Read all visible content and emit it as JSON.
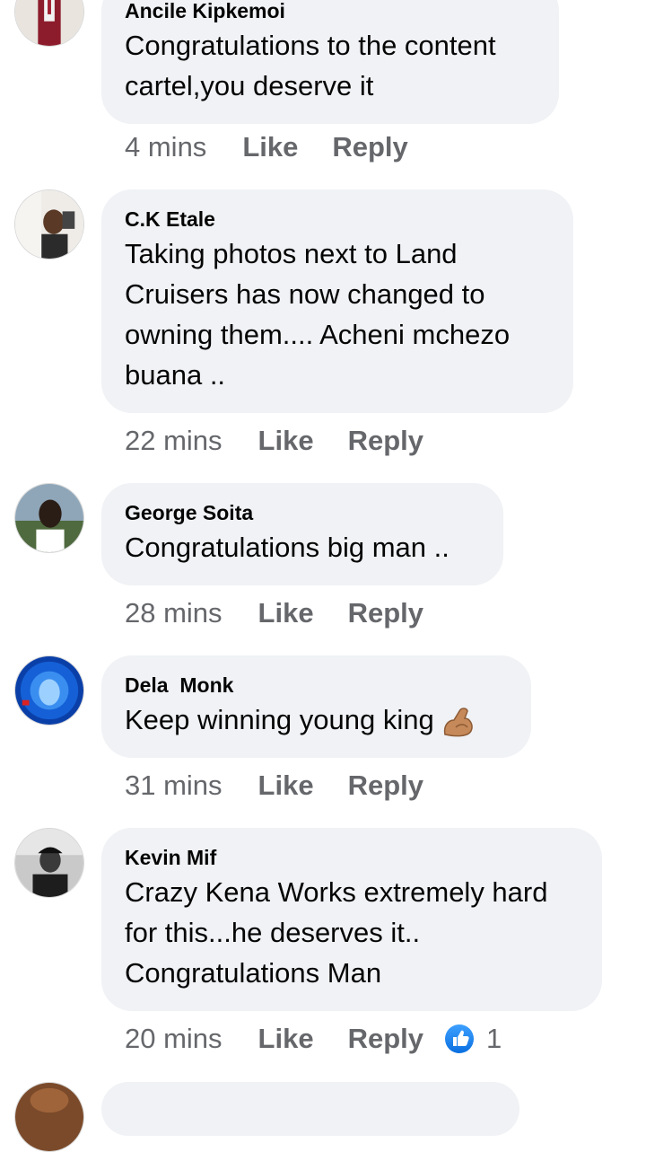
{
  "comments": [
    {
      "author": "Ancile Kipkemoi",
      "text": "Congratulations to the content cartel,you deserve it",
      "time": "4 mins",
      "like": "Like",
      "reply": "Reply"
    },
    {
      "author": "C.K Etale",
      "text": "Taking photos next to Land Cruisers has now changed to owning them.... Acheni mchezo buana ..",
      "time": "22 mins",
      "like": "Like",
      "reply": "Reply"
    },
    {
      "author": "George Soita",
      "text": "Congratulations big man ..",
      "time": "28 mins",
      "like": "Like",
      "reply": "Reply"
    },
    {
      "author": "Dela  Monk",
      "text": "Keep winning young king",
      "emoji": "flexed-biceps-emoji",
      "time": "31 mins",
      "like": "Like",
      "reply": "Reply"
    },
    {
      "author": "Kevin Mif",
      "text": "Crazy Kena Works extremely hard for this...he deserves it.. Congratulations Man",
      "time": "20 mins",
      "like": "Like",
      "reply": "Reply",
      "reaction_count": "1",
      "reaction_icon": "thumbs-up-icon"
    }
  ],
  "colors": {
    "bubble": "#f0f2f5",
    "meta_text": "#65676b",
    "like_blue": "#1877f2"
  }
}
